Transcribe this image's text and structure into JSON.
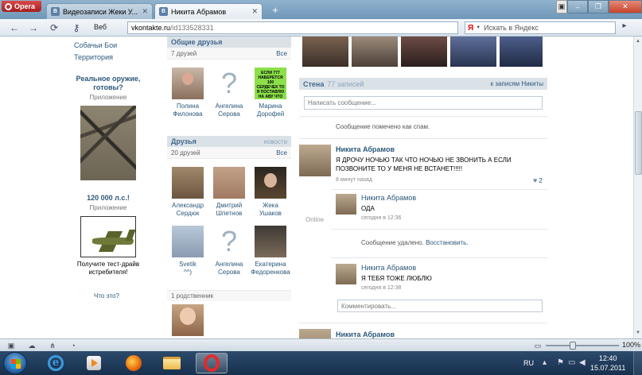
{
  "browser": {
    "menu_label": "Opera",
    "tabs": [
      {
        "label": "Видеозаписи Жеки У...",
        "favicon": "B",
        "active": false
      },
      {
        "label": "Никита Абрамов",
        "favicon": "B",
        "active": true
      }
    ],
    "web_label": "Веб",
    "url_domain": "vkontakte.ru",
    "url_path": "/id133528331",
    "search_engine": "Я",
    "search_placeholder": "Искать в Яндекс",
    "zoom": "100%"
  },
  "left": {
    "menu": [
      "Собачьи Бои",
      "Территория"
    ],
    "ads": [
      {
        "title": "Реальное оружие, готовы?",
        "sub": "Приложение",
        "text": ""
      },
      {
        "title": "120 000 л.с.!",
        "sub": "Приложение",
        "text": "Получите тест-драйв истребителя!"
      }
    ],
    "what_link": "Что это?"
  },
  "mutual": {
    "title": "Общие друзья",
    "count": "7 друзей",
    "all": "Все",
    "friends": [
      {
        "first": "Полина",
        "last": "Филонова"
      },
      {
        "first": "Ангелина",
        "last": "Серова"
      },
      {
        "first": "Марина",
        "last": "Дорофей"
      }
    ],
    "green_text": "ЕСЛИ 777 НАБЕРЕТСЯ 100 СЕРДЕЧЕК ТО Я ПОСТАВЛЮ НА АВУ ЧТО ВЫ ХОТИТЕ"
  },
  "friends": {
    "title": "Друзья",
    "news": "новости",
    "count": "20 друзей",
    "all": "Все",
    "list": [
      {
        "first": "Александр",
        "last": "Сердюк"
      },
      {
        "first": "Дмитрий",
        "last": "Шпетнов"
      },
      {
        "first": "Жека",
        "last": "Ушаков"
      },
      {
        "first": "Svetik",
        "last": "^^)"
      },
      {
        "first": "Ангелина",
        "last": "Серова"
      },
      {
        "first": "Екатерина",
        "last": "Федоренкова"
      }
    ]
  },
  "relatives": {
    "title": "1 родственник"
  },
  "wall": {
    "title": "Стена",
    "count": "77 записей",
    "to_posts": "к записям Никиты",
    "input_placeholder": "Написать сообщение...",
    "spam_notice": "Сообщение помечено как спам.",
    "post": {
      "author": "Никита Абрамов",
      "text": "Я ДРОЧУ НОЧЬЮ ТАК ЧТО НОЧЬЮ НЕ ЗВОНИТЬ А ЕСЛИ ПОЗВОНИТЕ ТО У МЕНЯ НЕ ВСТАНЕТ!!!!!",
      "time": "8 минут назад",
      "online": "Online",
      "likes": "2"
    },
    "comments": [
      {
        "author": "Никита Абрамов",
        "text": "ОДА",
        "time": "сегодня в 12:36"
      },
      {
        "author": "Никита Абрамов",
        "text": "Я ТЕБЯ ТОЖЕ ЛЮБЛЮ",
        "time": "сегодня в 12:38"
      }
    ],
    "deleted_text": "Сообщение удалено.",
    "restore": "Восстановить.",
    "comment_placeholder": "Комментировать...",
    "next_author": "Никита Абрамов"
  },
  "taskbar": {
    "lang": "RU",
    "time": "12:40",
    "date": "15.07.2011"
  }
}
